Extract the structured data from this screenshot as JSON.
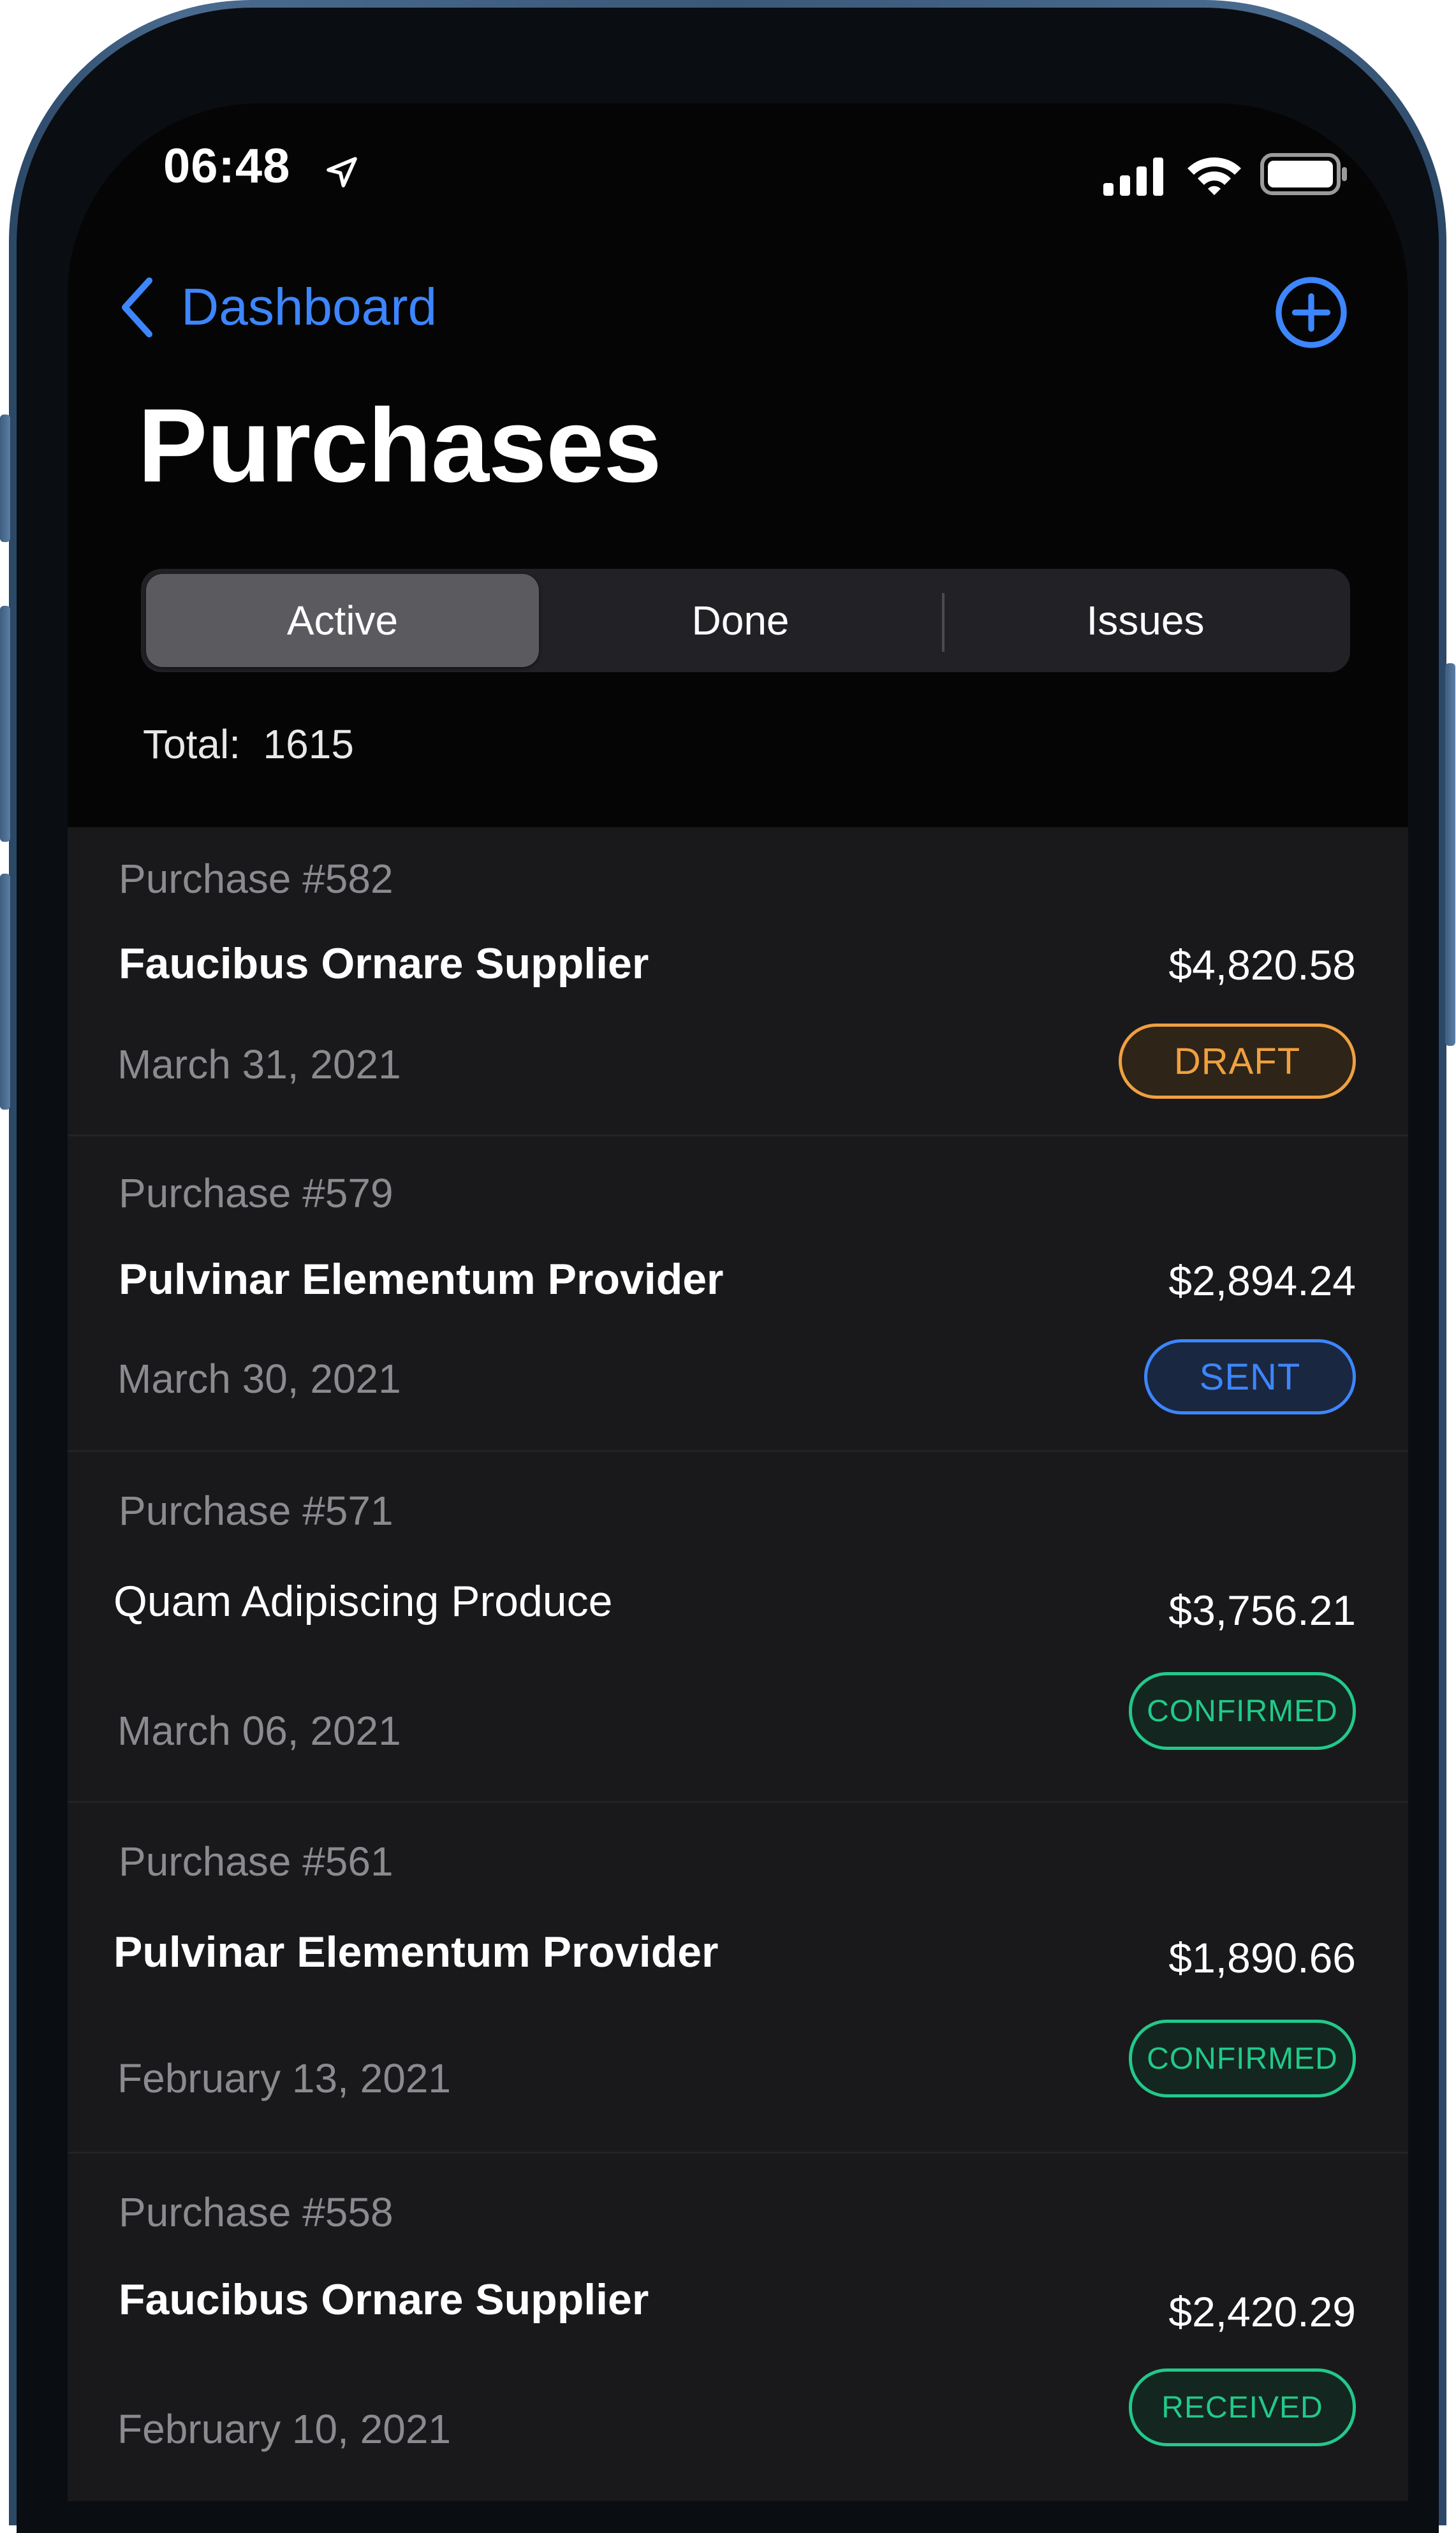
{
  "status_bar": {
    "time": "06:48"
  },
  "nav": {
    "back_label": "Dashboard",
    "title": "Purchases",
    "add_icon": "plus-circle-icon"
  },
  "segments": [
    {
      "label": "Active",
      "selected": true
    },
    {
      "label": "Done",
      "selected": false
    },
    {
      "label": "Issues",
      "selected": false
    }
  ],
  "summary": {
    "total_text": "Total:  1615"
  },
  "colors": {
    "accent": "#3d86ff",
    "draft": "#f0a040",
    "sent": "#3d86ff",
    "confirmed": "#22c98a",
    "received": "#22c98a"
  },
  "purchases": [
    {
      "number": "Purchase #582",
      "vendor": "Faucibus Ornare Supplier",
      "date": "March 31, 2021",
      "amount": "$4,820.58",
      "status": "DRAFT"
    },
    {
      "number": "Purchase #579",
      "vendor": "Pulvinar Elementum Provider",
      "date": "March 30, 2021",
      "amount": "$2,894.24",
      "status": "SENT"
    },
    {
      "number": "Purchase #571",
      "vendor": "Quam Adipiscing Produce",
      "date": "March 06, 2021",
      "amount": "$3,756.21",
      "status": "CONFIRMED"
    },
    {
      "number": "Purchase #561",
      "vendor": "Pulvinar Elementum Provider",
      "date": "February 13, 2021",
      "amount": "$1,890.66",
      "status": "CONFIRMED"
    },
    {
      "number": "Purchase #558",
      "vendor": "Faucibus Ornare Supplier",
      "date": "February 10, 2021",
      "amount": "$2,420.29",
      "status": "RECEIVED"
    }
  ]
}
